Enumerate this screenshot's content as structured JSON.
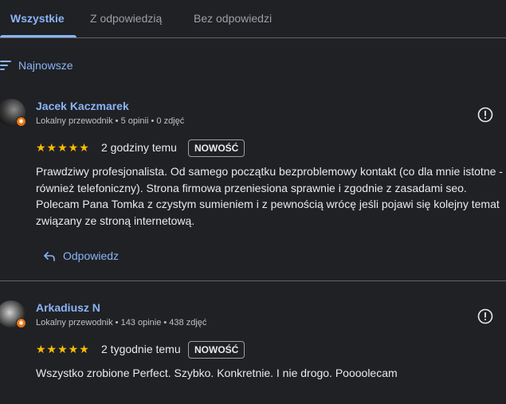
{
  "tabs": [
    {
      "label": "Wszystkie"
    },
    {
      "label": "Z odpowiedzią"
    },
    {
      "label": "Bez odpowiedzi"
    }
  ],
  "sort": {
    "label": "Najnowsze",
    "icon": "sort-icon"
  },
  "reviews": [
    {
      "name": "Jacek Kaczmarek",
      "meta": "Lokalny przewodnik • 5 opinii • 0 zdjęć",
      "stars": "★★★★★",
      "rating": 5,
      "time": "2 godziny temu",
      "badge": "NOWOŚĆ",
      "text": "Prawdziwy profesjonalista. Od samego początku bezproblemowy kontakt (co dla mnie istotne - również telefoniczny). Strona firmowa przeniesiona sprawnie i zgodnie z zasadami seo. Polecam Pana Tomka z czystym sumieniem i z pewnością wrócę jeśli pojawi się kolejny temat związany ze stroną internetową.",
      "reply_label": "Odpowiedz"
    },
    {
      "name": "Arkadiusz N",
      "meta": "Lokalny przewodnik • 143 opinie • 438 zdjęć",
      "stars": "★★★★★",
      "rating": 5,
      "time": "2 tygodnie temu",
      "badge": "NOWOŚĆ",
      "text": "Wszystko zrobione Perfect. Szybko. Konkretnie. I nie drogo. Poooolecam"
    }
  ],
  "colors": {
    "background": "#202124",
    "accent": "#8ab4f8",
    "star": "#fbbc04",
    "badge_local_guide": "#e8710a"
  }
}
